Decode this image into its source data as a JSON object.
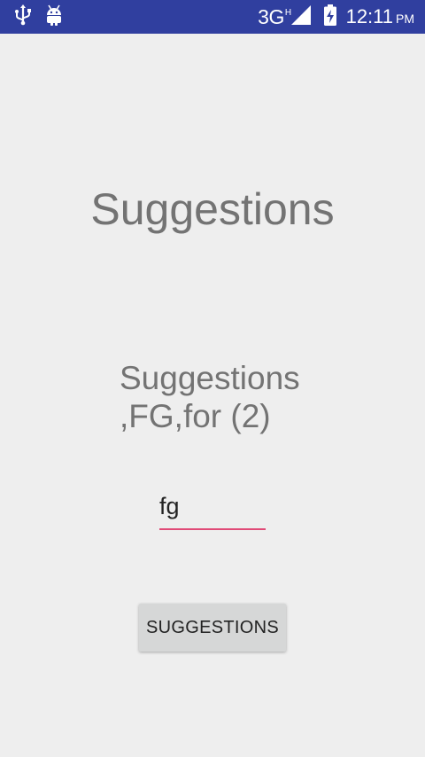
{
  "status_bar": {
    "network_type": "3G",
    "network_sup": "H",
    "time": "12:11",
    "ampm": "PM",
    "background": "#303f9f",
    "icons": [
      "usb-icon",
      "android-debug-icon",
      "signal-icon",
      "battery-charging-icon"
    ]
  },
  "main": {
    "title": "Suggestions",
    "result_text": "Suggestions ,FG,for (2)",
    "input": {
      "value": "fg",
      "underline_color": "#e04a77"
    },
    "button_label": "SUGGESTIONS"
  }
}
